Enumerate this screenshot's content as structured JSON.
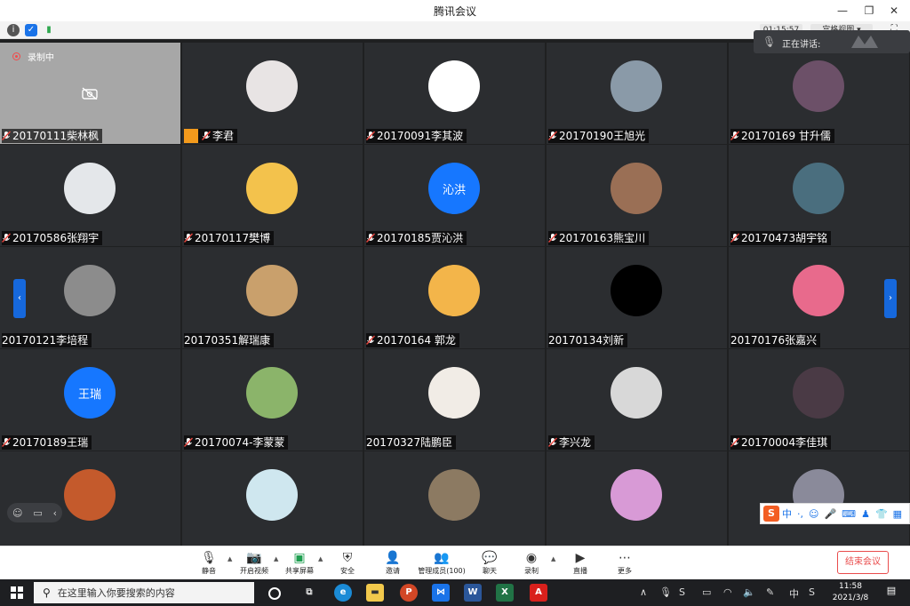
{
  "window": {
    "title": "腾讯会议"
  },
  "infobar": {
    "timer": "01:15:57",
    "layout": "宫格视图"
  },
  "speaking": {
    "label": "正在讲话:"
  },
  "tiles": [
    {
      "name": "20170111柴林枫",
      "bg": "#a7a7a7",
      "avatar": "none",
      "recording": "录制中"
    },
    {
      "name": "李君",
      "bg": "#2b2d30",
      "avatar": "#e8e4e4",
      "host": true
    },
    {
      "name": "20170091李其波",
      "bg": "#2b2d30",
      "avatar": "#ffffff"
    },
    {
      "name": "20170190王旭光",
      "bg": "#2b2d30",
      "avatar": "#8a9aa8"
    },
    {
      "name": "20170169 甘升儒",
      "bg": "#2b2d30",
      "avatar": "#6c5068"
    },
    {
      "name": "20170586张翔宇",
      "bg": "#2b2d30",
      "avatar": "#e4e7ea"
    },
    {
      "name": "20170117樊博",
      "bg": "#2b2d30",
      "avatar": "#f3c24c"
    },
    {
      "name": "20170185贾沁洪",
      "bg": "#2b2d30",
      "avatar": "#1677ff",
      "initials": "沁洪"
    },
    {
      "name": "20170163熊宝川",
      "bg": "#2b2d30",
      "avatar": "#9a6f55"
    },
    {
      "name": "20170473胡宇铭",
      "bg": "#2b2d30",
      "avatar": "#4a6e7e"
    },
    {
      "name": "20170121李培程",
      "bg": "#2b2d30",
      "avatar": "#8c8c8c",
      "nomic": true
    },
    {
      "name": "20170351解瑞康",
      "bg": "#2b2d30",
      "avatar": "#c9a06c",
      "nomic": true
    },
    {
      "name": "20170164 郭龙",
      "bg": "#2b2d30",
      "avatar": "#f3b54a"
    },
    {
      "name": "20170134刘新",
      "bg": "#2b2d30",
      "avatar": "#000000",
      "nomic": true
    },
    {
      "name": "20170176张嘉兴",
      "bg": "#2b2d30",
      "avatar": "#e86a8c",
      "nomic": true
    },
    {
      "name": "20170189王瑞",
      "bg": "#2b2d30",
      "avatar": "#1677ff",
      "initials": "王瑞"
    },
    {
      "name": "20170074-李蒙蒙",
      "bg": "#2b2d30",
      "avatar": "#8bb46a"
    },
    {
      "name": "20170327陆鹏臣",
      "bg": "#2b2d30",
      "avatar": "#f1ece6",
      "nomic": true
    },
    {
      "name": "李兴龙",
      "bg": "#2b2d30",
      "avatar": "#d8d8d8"
    },
    {
      "name": "20170004李佳琪",
      "bg": "#2b2d30",
      "avatar": "#4a3a45"
    },
    {
      "name": "",
      "bg": "#2b2d30",
      "avatar": "#c45a2c"
    },
    {
      "name": "",
      "bg": "#2b2d30",
      "avatar": "#cfe7ef"
    },
    {
      "name": "",
      "bg": "#2b2d30",
      "avatar": "#8c7a62"
    },
    {
      "name": "",
      "bg": "#2b2d30",
      "avatar": "#d89ad6"
    },
    {
      "name": "",
      "bg": "#2b2d30",
      "avatar": "#8a8a9a"
    }
  ],
  "ime": {
    "lang": "中"
  },
  "toolbar": {
    "mute": "静音",
    "video": "开启视频",
    "share": "共享屏幕",
    "security": "安全",
    "invite": "邀请",
    "members": "管理成员(100)",
    "chat": "聊天",
    "record": "录制",
    "live": "直播",
    "more": "更多",
    "end": "结束会议"
  },
  "taskbar": {
    "search_placeholder": "在这里输入你要搜索的内容",
    "ime": "中",
    "time": "11:58",
    "date": "2021/3/8"
  }
}
